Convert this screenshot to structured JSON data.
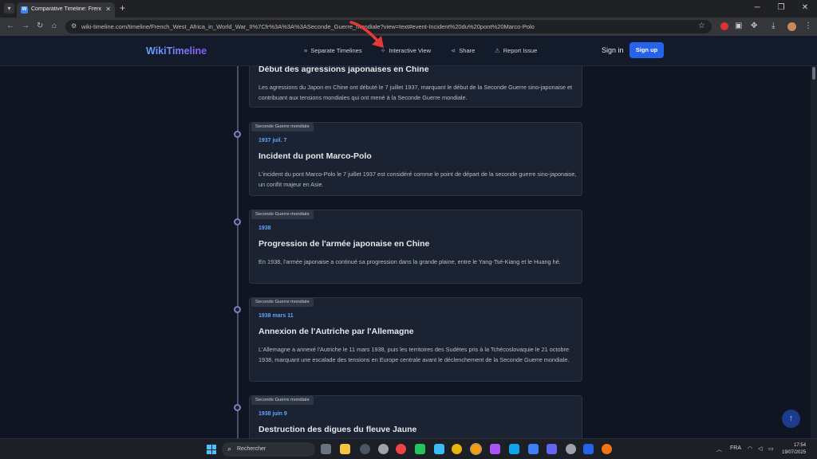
{
  "browser": {
    "tab_title": "Comparative Timeline: French W",
    "url": "wiki-timeline.com/timeline/French_West_Africa_in_World_War_II%7Cfr%3A%3A%3ASeconde_Guerre_mondiale?view=text#event-Incident%20du%20pont%20Marco-Polo"
  },
  "header": {
    "logo": "WikiTimeline",
    "nav": [
      {
        "label": "Separate Timelines",
        "icon": "list-icon"
      },
      {
        "label": "Interactive View",
        "icon": "sparkle-icon"
      },
      {
        "label": "Share",
        "icon": "share-icon"
      },
      {
        "label": "Report Issue",
        "icon": "warning-icon"
      }
    ],
    "signin": "Sign in",
    "signup": "Sign up"
  },
  "events": [
    {
      "title": "Début des agressions japonaises en Chine",
      "description": "Les agressions du Japon en Chine ont débuté le 7 juillet 1937, marquant le début de la Seconde Guerre sino-japonaise et contribuant aux tensions mondiales qui ont mené à la Seconde Guerre mondiale."
    },
    {
      "category": "Seconde Guerre mondiale",
      "date": "1937 juil. 7",
      "title": "Incident du pont Marco-Polo",
      "description": "L'incident du pont Marco-Polo le 7 juillet 1937 est considéré comme le point de départ de la seconde guerre sino-japonaise, un conflit majeur en Asie."
    },
    {
      "category": "Seconde Guerre mondiale",
      "date": "1938",
      "title": "Progression de l'armée japonaise en Chine",
      "description": "En 1938, l'armée japonaise a continué sa progression dans la grande plaine, entre le Yang-Tsé-Kiang et le Huang hé."
    },
    {
      "category": "Seconde Guerre mondiale",
      "date": "1938 mars 11",
      "title": "Annexion de l'Autriche par l'Allemagne",
      "description": "L'Allemagne a annexé l'Autriche le 11 mars 1938, puis les territoires des Sudètes pris à la Tchécoslovaquie le 21 octobre 1938, marquant une escalade des tensions en Europe centrale avant le déclenchement de la Seconde Guerre mondiale."
    },
    {
      "category": "Seconde Guerre mondiale",
      "date": "1938 juin 9",
      "title": "Destruction des digues du fleuve Jaune"
    }
  ],
  "taskbar": {
    "search_placeholder": "Rechercher",
    "language": "FRA",
    "time": "17:54",
    "date": "19/07/2025"
  },
  "colors": {
    "accent": "#2563eb",
    "date_blue": "#60a5fa",
    "annotation_red": "#e53935"
  }
}
